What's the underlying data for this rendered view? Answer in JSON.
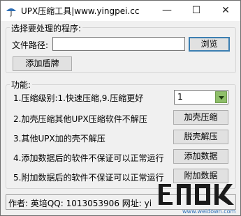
{
  "window": {
    "title": "UPX压缩工具|www.yingpei.cc",
    "minimize_glyph": "—",
    "maximize_glyph": "☐",
    "close_glyph": "✕",
    "icon": "umbrella-app-icon"
  },
  "program_group": {
    "legend": "选择要处理的程序:",
    "path_label": "文件路径:",
    "path_value": "",
    "browse_label": "浏览",
    "add_shell_label": "添加盾牌"
  },
  "function_group": {
    "legend": "功能:",
    "level_label": "1.压缩级别:1.快速压缩,9.压缩更好",
    "level_value": "1",
    "row2_label": "2.加壳压缩其他UPX压缩软件不解压",
    "row2_button": "加壳压缩",
    "row3_label": "3.其他UPX加的壳不解压",
    "row3_button": "脱壳解压",
    "row4_label": "4.添加数据后的软件不保证可以正常运行",
    "row4_button": "添加数据",
    "row5_label": "5.附加数据后的软件不保证可以正常运行",
    "row5_button": "附加数据"
  },
  "status": {
    "text": "作者: 英培QQ: 1013053906 网址: yi"
  },
  "watermark": {
    "text": "www.weidown.com"
  },
  "colors": {
    "focus_border": "#3c7fb1",
    "select_arrow_bg": "#8fbf6a"
  }
}
